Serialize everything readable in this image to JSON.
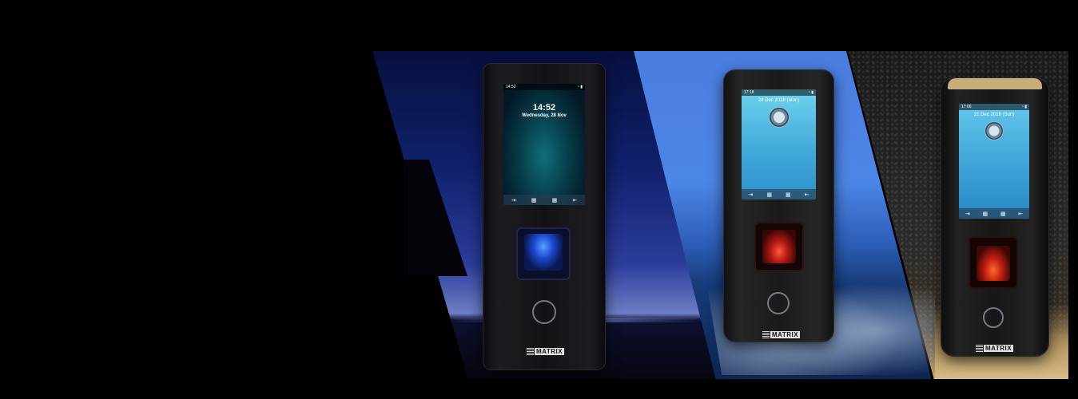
{
  "devices": [
    {
      "status_time": "14:52",
      "clock": "14:52",
      "date": "Wednesday, 28 Nov",
      "brand": "MATRIX"
    },
    {
      "status_time": "17:18",
      "date": "24 Dec 2018 (Mon)",
      "brand": "MATRIX"
    },
    {
      "status_time": "17:06",
      "date": "21 Dec 2018 (Sun)",
      "brand": "MATRIX"
    }
  ],
  "icons": {
    "nav": [
      "login-icon",
      "grid-icon",
      "grid-icon",
      "logout-icon"
    ],
    "status": [
      "wifi-icon",
      "battery-icon"
    ]
  },
  "colors": {
    "background": "#000000",
    "reader_blue": "#58a0ff",
    "reader_red": "#ff5a3a",
    "screen_blue": "#3ea7d9"
  }
}
